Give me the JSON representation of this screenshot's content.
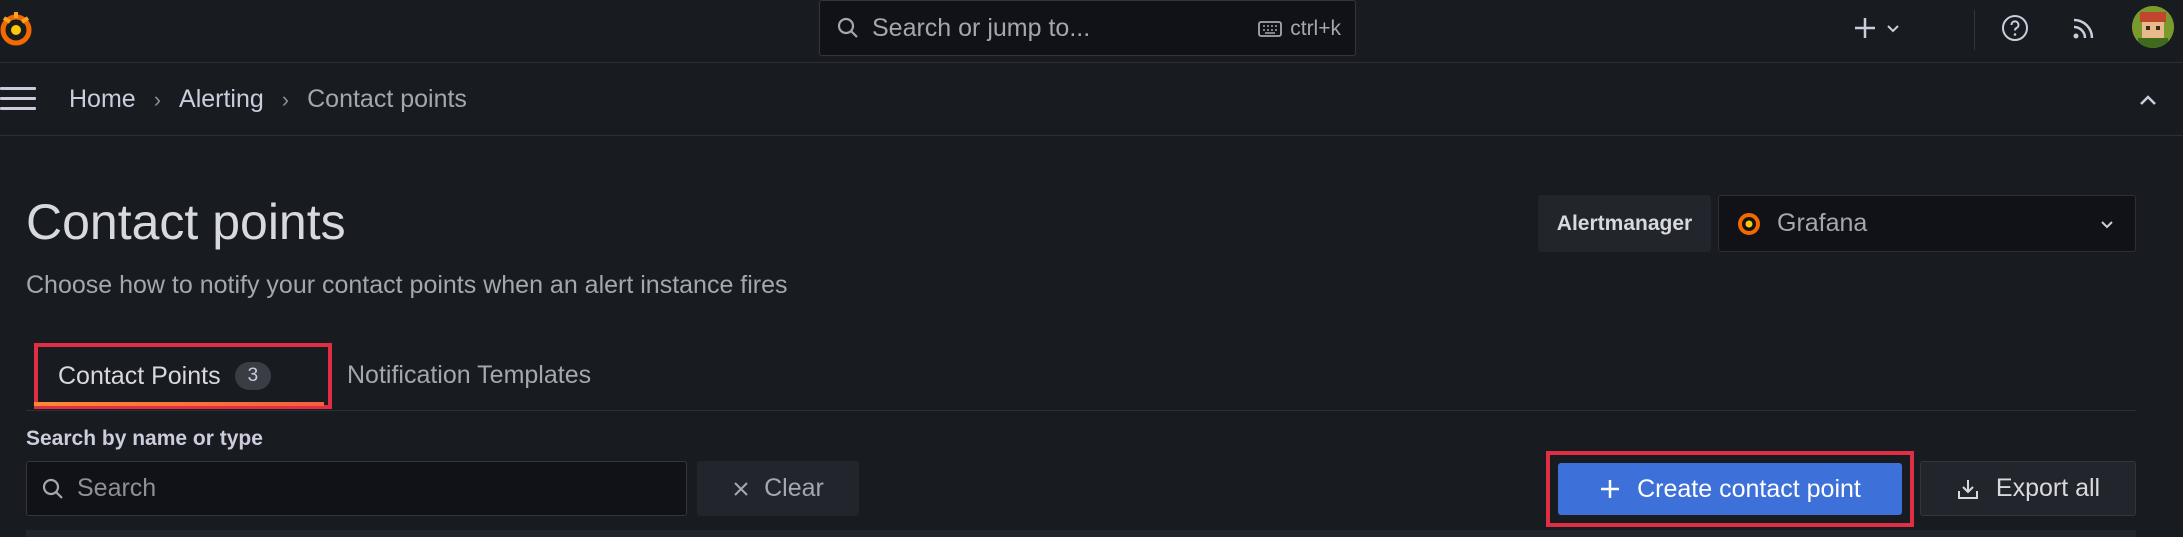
{
  "topbar": {
    "search_placeholder": "Search or jump to...",
    "shortcut": "ctrl+k"
  },
  "breadcrumb": [
    "Home",
    "Alerting",
    "Contact points"
  ],
  "page": {
    "title": "Contact points",
    "subtitle": "Choose how to notify your contact points when an alert instance fires"
  },
  "alertmanager": {
    "label": "Alertmanager",
    "selected": "Grafana"
  },
  "tabs": [
    {
      "label": "Contact Points",
      "count": "3",
      "active": true
    },
    {
      "label": "Notification Templates",
      "active": false
    }
  ],
  "filter": {
    "label": "Search by name or type",
    "placeholder": "Search",
    "clear_label": "Clear"
  },
  "actions": {
    "create_label": "Create contact point",
    "export_label": "Export all"
  },
  "colors": {
    "primary": "#3d71d9",
    "highlight": "#e02f44",
    "background": "#181b1f"
  }
}
